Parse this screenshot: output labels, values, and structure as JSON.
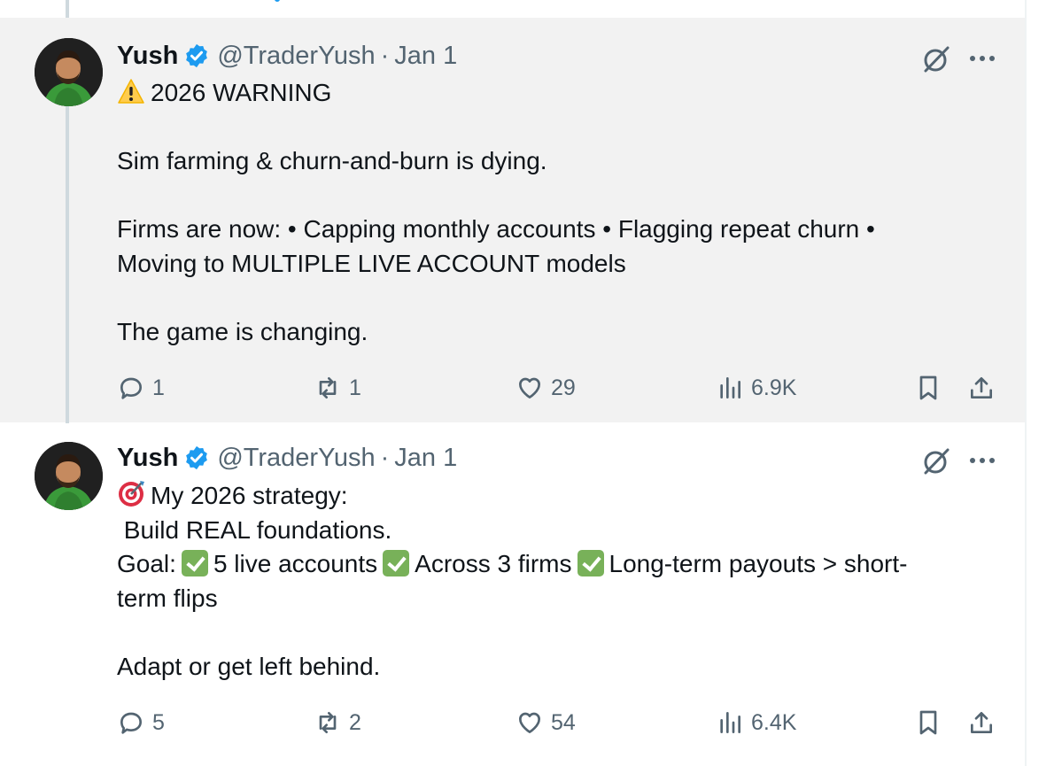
{
  "tweets": [
    {
      "author": {
        "name": "Yush",
        "handle": "@TraderYush",
        "date": "Jan 1",
        "verified": true
      },
      "lines": [
        "2026 WARNING",
        "",
        "Sim farming & churn-and-burn is dying.",
        "",
        "Firms are now: • Capping monthly accounts • Flagging repeat churn •",
        "Moving to MULTIPLE LIVE ACCOUNT models",
        "",
        "The game is changing."
      ],
      "leading_emoji": "warning-icon",
      "stats": {
        "replies": "1",
        "reposts": "1",
        "likes": "29",
        "views": "6.9K"
      }
    },
    {
      "author": {
        "name": "Yush",
        "handle": "@TraderYush",
        "date": "Jan 1",
        "verified": true
      },
      "leading_emoji": "target-icon",
      "line1": "My 2026 strategy:",
      "line2": " Build REAL foundations.",
      "goal_label": "Goal:",
      "goals": [
        "5 live accounts",
        "Across 3 firms",
        "Long-term payouts > short-"
      ],
      "goal_tail": "term flips",
      "closing": "Adapt or get left behind.",
      "stats": {
        "replies": "5",
        "reposts": "2",
        "likes": "54",
        "views": "6.4K"
      }
    }
  ],
  "colors": {
    "accent": "#1d9bf0",
    "muted": "#536471",
    "check": "#78b159",
    "highlight_bg": "#f2f2f2"
  }
}
